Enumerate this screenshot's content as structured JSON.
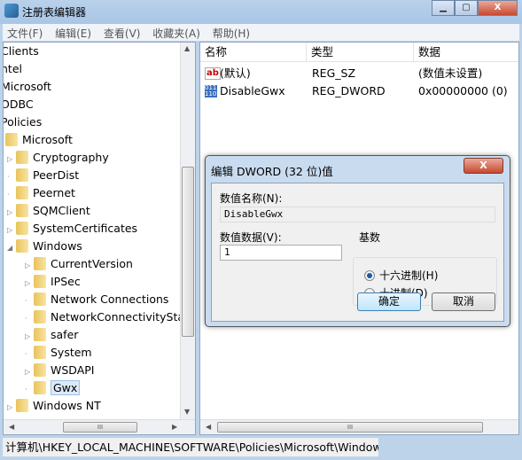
{
  "window": {
    "title": "注册表编辑器",
    "minimize": "▁",
    "maximize": "▢",
    "close": "X"
  },
  "menu": [
    "文件(F)",
    "编辑(E)",
    "查看(V)",
    "收藏夹(A)",
    "帮助(H)"
  ],
  "tree": [
    {
      "label": "Clients",
      "level": -1
    },
    {
      "label": "ntel",
      "level": -1
    },
    {
      "label": "Microsoft",
      "level": -1
    },
    {
      "label": "ODBC",
      "level": -1
    },
    {
      "label": "Policies",
      "level": -1
    },
    {
      "label": "Microsoft",
      "level": 0,
      "arrow": ""
    },
    {
      "label": "Cryptography",
      "level": 1,
      "arrow": "▷"
    },
    {
      "label": "PeerDist",
      "level": 1,
      "arrow": ""
    },
    {
      "label": "Peernet",
      "level": 1,
      "arrow": ""
    },
    {
      "label": "SQMClient",
      "level": 1,
      "arrow": "▷"
    },
    {
      "label": "SystemCertificates",
      "level": 1,
      "arrow": "▷"
    },
    {
      "label": "Windows",
      "level": 1,
      "arrow": "◢"
    },
    {
      "label": "CurrentVersion",
      "level": 2,
      "arrow": "▷"
    },
    {
      "label": "IPSec",
      "level": 2,
      "arrow": "▷"
    },
    {
      "label": "Network Connections",
      "level": 2,
      "arrow": ""
    },
    {
      "label": "NetworkConnectivityStat",
      "level": 2,
      "arrow": ""
    },
    {
      "label": "safer",
      "level": 2,
      "arrow": "▷"
    },
    {
      "label": "System",
      "level": 2,
      "arrow": ""
    },
    {
      "label": "WSDAPI",
      "level": 2,
      "arrow": "▷"
    },
    {
      "label": "Gwx",
      "level": 2,
      "arrow": "",
      "selected": true
    },
    {
      "label": "Windows NT",
      "level": 1,
      "arrow": "▷"
    }
  ],
  "list": {
    "columns": [
      "名称",
      "类型",
      "数据"
    ],
    "rows": [
      {
        "icon": "string-value-icon",
        "name": "(默认)",
        "type": "REG_SZ",
        "data": "(数值未设置)"
      },
      {
        "icon": "binary-value-icon",
        "name": "DisableGwx",
        "type": "REG_DWORD",
        "data": "0x00000000 (0)"
      }
    ]
  },
  "status": "计算机\\HKEY_LOCAL_MACHINE\\SOFTWARE\\Policies\\Microsoft\\Windows\\",
  "dialog": {
    "title": "编辑 DWORD (32 位)值",
    "close": "X",
    "name_label": "数值名称(N):",
    "name_value": "DisableGwx",
    "data_label": "数值数据(V):",
    "data_value": "1",
    "base_label": "基数",
    "hex_label": "十六进制(H)",
    "dec_label": "十进制(D)",
    "base_selected": "hex",
    "ok": "确定",
    "cancel": "取消"
  },
  "scroll": {
    "h": "III"
  }
}
